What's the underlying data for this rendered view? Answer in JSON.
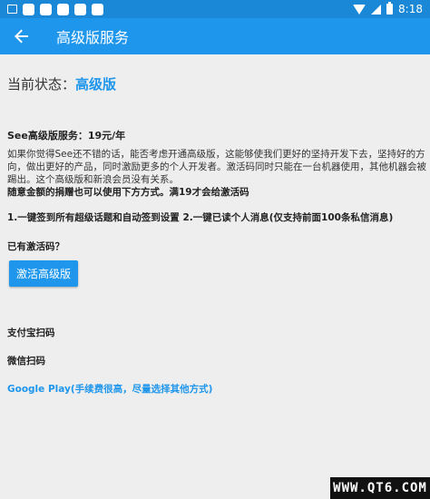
{
  "statusbar": {
    "time": "8:18",
    "icons": [
      "image-icon",
      "notification-icon",
      "notification-icon",
      "notification-icon",
      "notification-icon",
      "notification-icon",
      "wifi-icon",
      "signal-icon",
      "battery-icon"
    ]
  },
  "appbar": {
    "back_icon": "arrow-left-icon",
    "title": "高级版服务"
  },
  "status": {
    "label": "当前状态：",
    "value": "高级版"
  },
  "price": "See高级版服务：19元/年",
  "description": "如果你觉得See还不错的话，能否考虑开通高级版，这能够使我们更好的坚持开发下去，坚持好的方向，做出更好的产品，同时激励更多的个人开发者。激活码同时只能在一台机器使用，其他机器会被踢出。这个高级版和新浪会员没有关系。",
  "description_bold": "随意金额的捐赠也可以使用下方方式。满19才会给激活码",
  "features": "1.一键签到所有超级话题和自动签到设置 2.一键已读个人消息(仅支持前面100条私信消息)",
  "has_code_label": "已有激活码？",
  "activate_button": "激活高级版",
  "payment": {
    "alipay": "支付宝扫码",
    "wechat": "微信扫码",
    "google_play": "Google Play(手续费很高，尽量选择其他方式)"
  },
  "watermark": "WWW.QT6.COM",
  "colors": {
    "statusbar": "#1a88d6",
    "appbar": "#1e96ec",
    "accent": "#1e96ec",
    "background": "#eeeeee"
  }
}
